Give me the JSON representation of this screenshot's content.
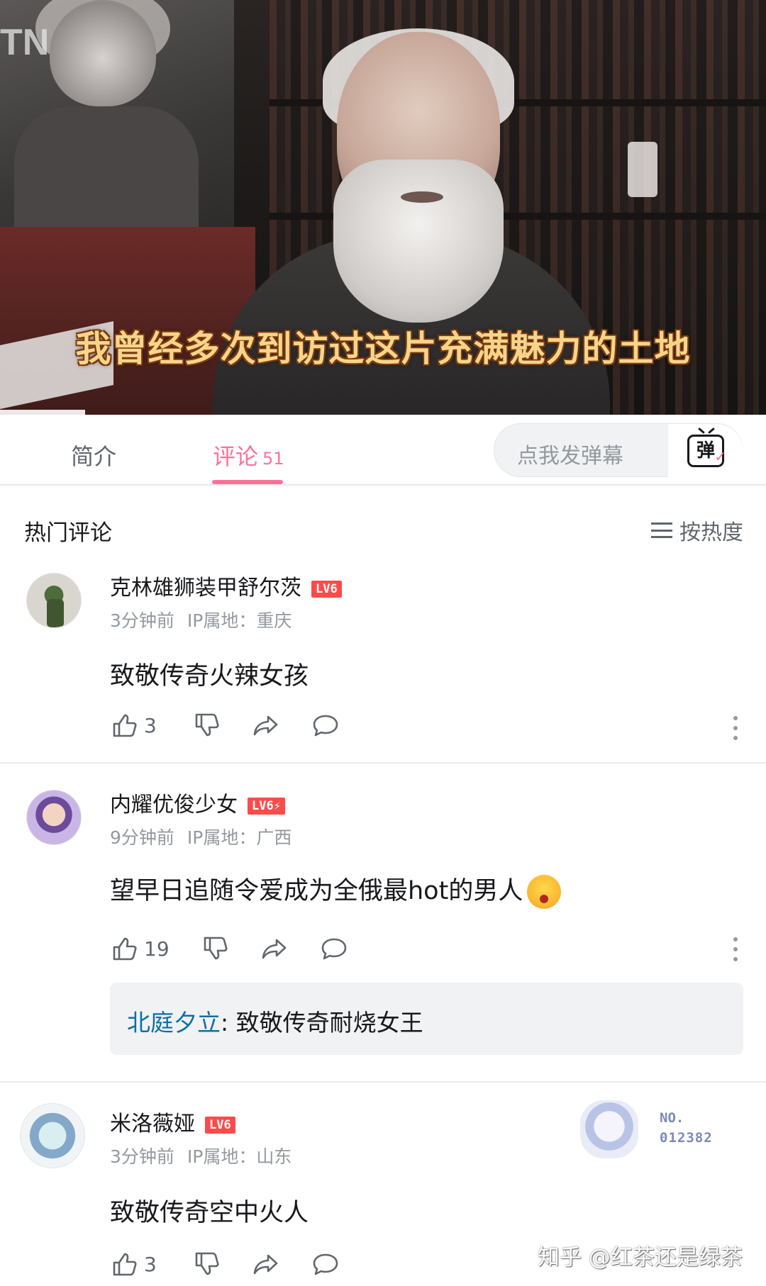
{
  "video": {
    "subtitle": "我曾经多次到访过这片充满魅力的土地",
    "overlay_text": "TN"
  },
  "tabs": {
    "intro_label": "简介",
    "comments_label": "评论",
    "comments_count": "51"
  },
  "danmaku": {
    "placeholder": "点我发弹幕",
    "button_glyph": "弹"
  },
  "section": {
    "title": "热门评论",
    "sort_label": "按热度"
  },
  "comments": [
    {
      "name": "克林雄狮装甲舒尔茨",
      "level": "LV6",
      "time": "3分钟前",
      "ip": "IP属地：重庆",
      "text": "致敬传奇火辣女孩",
      "likes": "3"
    },
    {
      "name": "内耀优俊少女",
      "level": "LV6⚡",
      "time": "9分钟前",
      "ip": "IP属地：广西",
      "text": "望早日追随令爱成为全俄最hot的男人",
      "likes": "19",
      "reply": {
        "user": "北庭夕立",
        "text": ": 致敬传奇耐烧女王"
      }
    },
    {
      "name": "米洛薇娅",
      "level": "LV6",
      "time": "3分钟前",
      "ip": "IP属地：山东",
      "text": "致敬传奇空中火人",
      "likes": "3",
      "fan_badge": {
        "label": "NO.",
        "number": "012382"
      }
    }
  ],
  "watermark": "知乎 @红茶还是绿茶",
  "colors": {
    "accent_pink": "#fb7299",
    "level_red": "#ff4a4a",
    "reply_user_blue": "#0f6fa5"
  }
}
